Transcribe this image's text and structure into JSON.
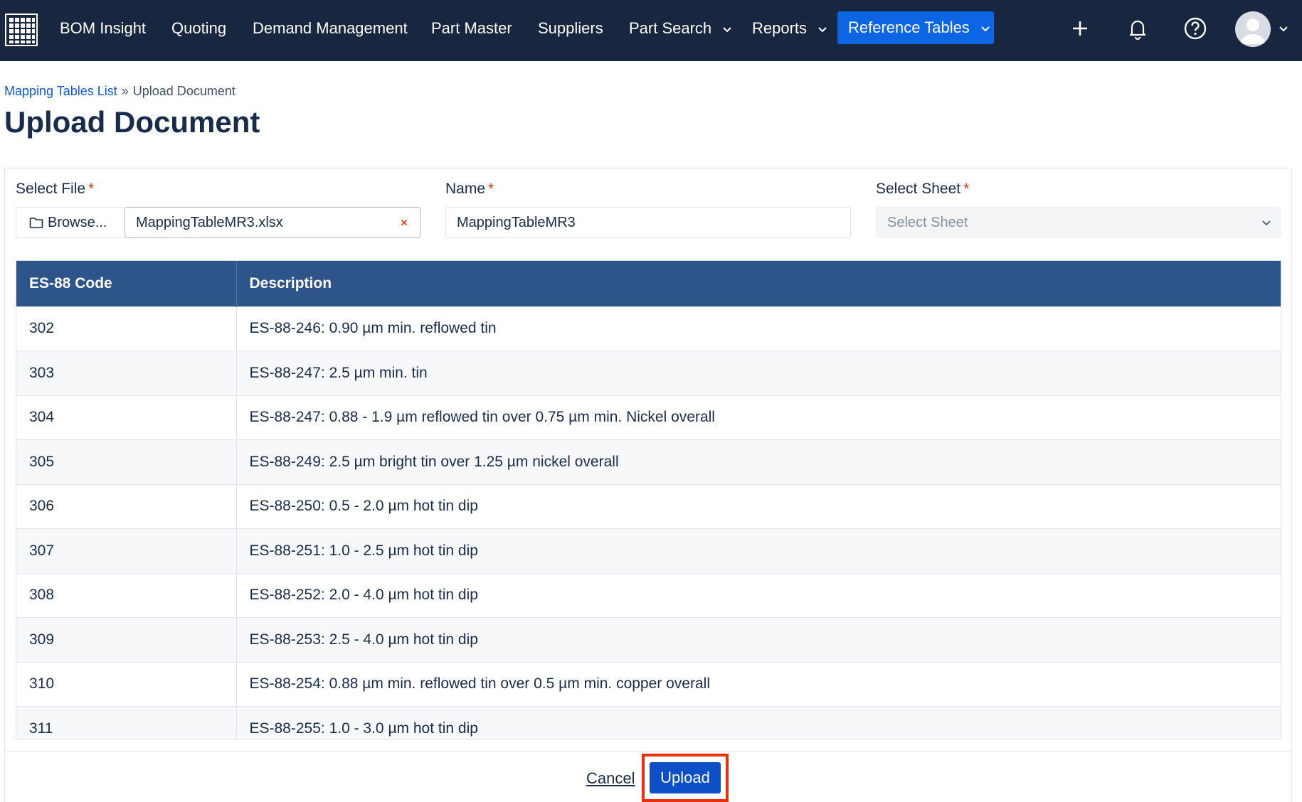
{
  "nav": {
    "items": [
      {
        "label": "BOM Insight"
      },
      {
        "label": "Quoting"
      },
      {
        "label": "Demand Management"
      },
      {
        "label": "Part Master"
      },
      {
        "label": "Suppliers"
      },
      {
        "label": "Part Search"
      },
      {
        "label": "Reports"
      }
    ],
    "active_label": "Reference Tables",
    "icons": [
      "add-icon",
      "bell-icon",
      "help-icon",
      "avatar"
    ],
    "colors": {
      "background": "#18263f",
      "active": "#0c66e4"
    }
  },
  "breadcrumb": {
    "parent": "Mapping Tables List",
    "separator": "»",
    "current": "Upload Document"
  },
  "page": {
    "title": "Upload Document"
  },
  "form": {
    "file": {
      "label": "Select File",
      "required": "*",
      "browse_label": "Browse...",
      "value": "MappingTableMR3.xlsx"
    },
    "name": {
      "label": "Name",
      "required": "*",
      "value": "MappingTableMR3"
    },
    "sheet": {
      "label": "Select Sheet",
      "required": "*",
      "placeholder": "Select Sheet"
    }
  },
  "table": {
    "headers": [
      "ES-88 Code",
      "Description"
    ],
    "rows": [
      {
        "code": "302",
        "description": "ES-88-246: 0.90 µm min. reflowed tin"
      },
      {
        "code": "303",
        "description": "ES-88-247: 2.5 µm min. tin"
      },
      {
        "code": "304",
        "description": "ES-88-247: 0.88 - 1.9 µm reflowed tin over 0.75 µm min. Nickel overall"
      },
      {
        "code": "305",
        "description": "ES-88-249: 2.5 µm bright tin over 1.25 µm nickel overall"
      },
      {
        "code": "306",
        "description": "ES-88-250: 0.5 - 2.0 µm hot tin dip"
      },
      {
        "code": "307",
        "description": "ES-88-251: 1.0 - 2.5 µm hot tin dip"
      },
      {
        "code": "308",
        "description": "ES-88-252: 2.0 - 4.0 µm hot tin dip"
      },
      {
        "code": "309",
        "description": "ES-88-253: 2.5 - 4.0 µm hot tin dip"
      },
      {
        "code": "310",
        "description": "ES-88-254: 0.88 µm min. reflowed tin over 0.5 µm min. copper overall"
      },
      {
        "code": "311",
        "description": "ES-88-255: 1.0 - 3.0 µm hot tin dip"
      }
    ]
  },
  "footer": {
    "cancel_label": "Cancel",
    "upload_label": "Upload",
    "highlight_color": "#e8300d"
  }
}
